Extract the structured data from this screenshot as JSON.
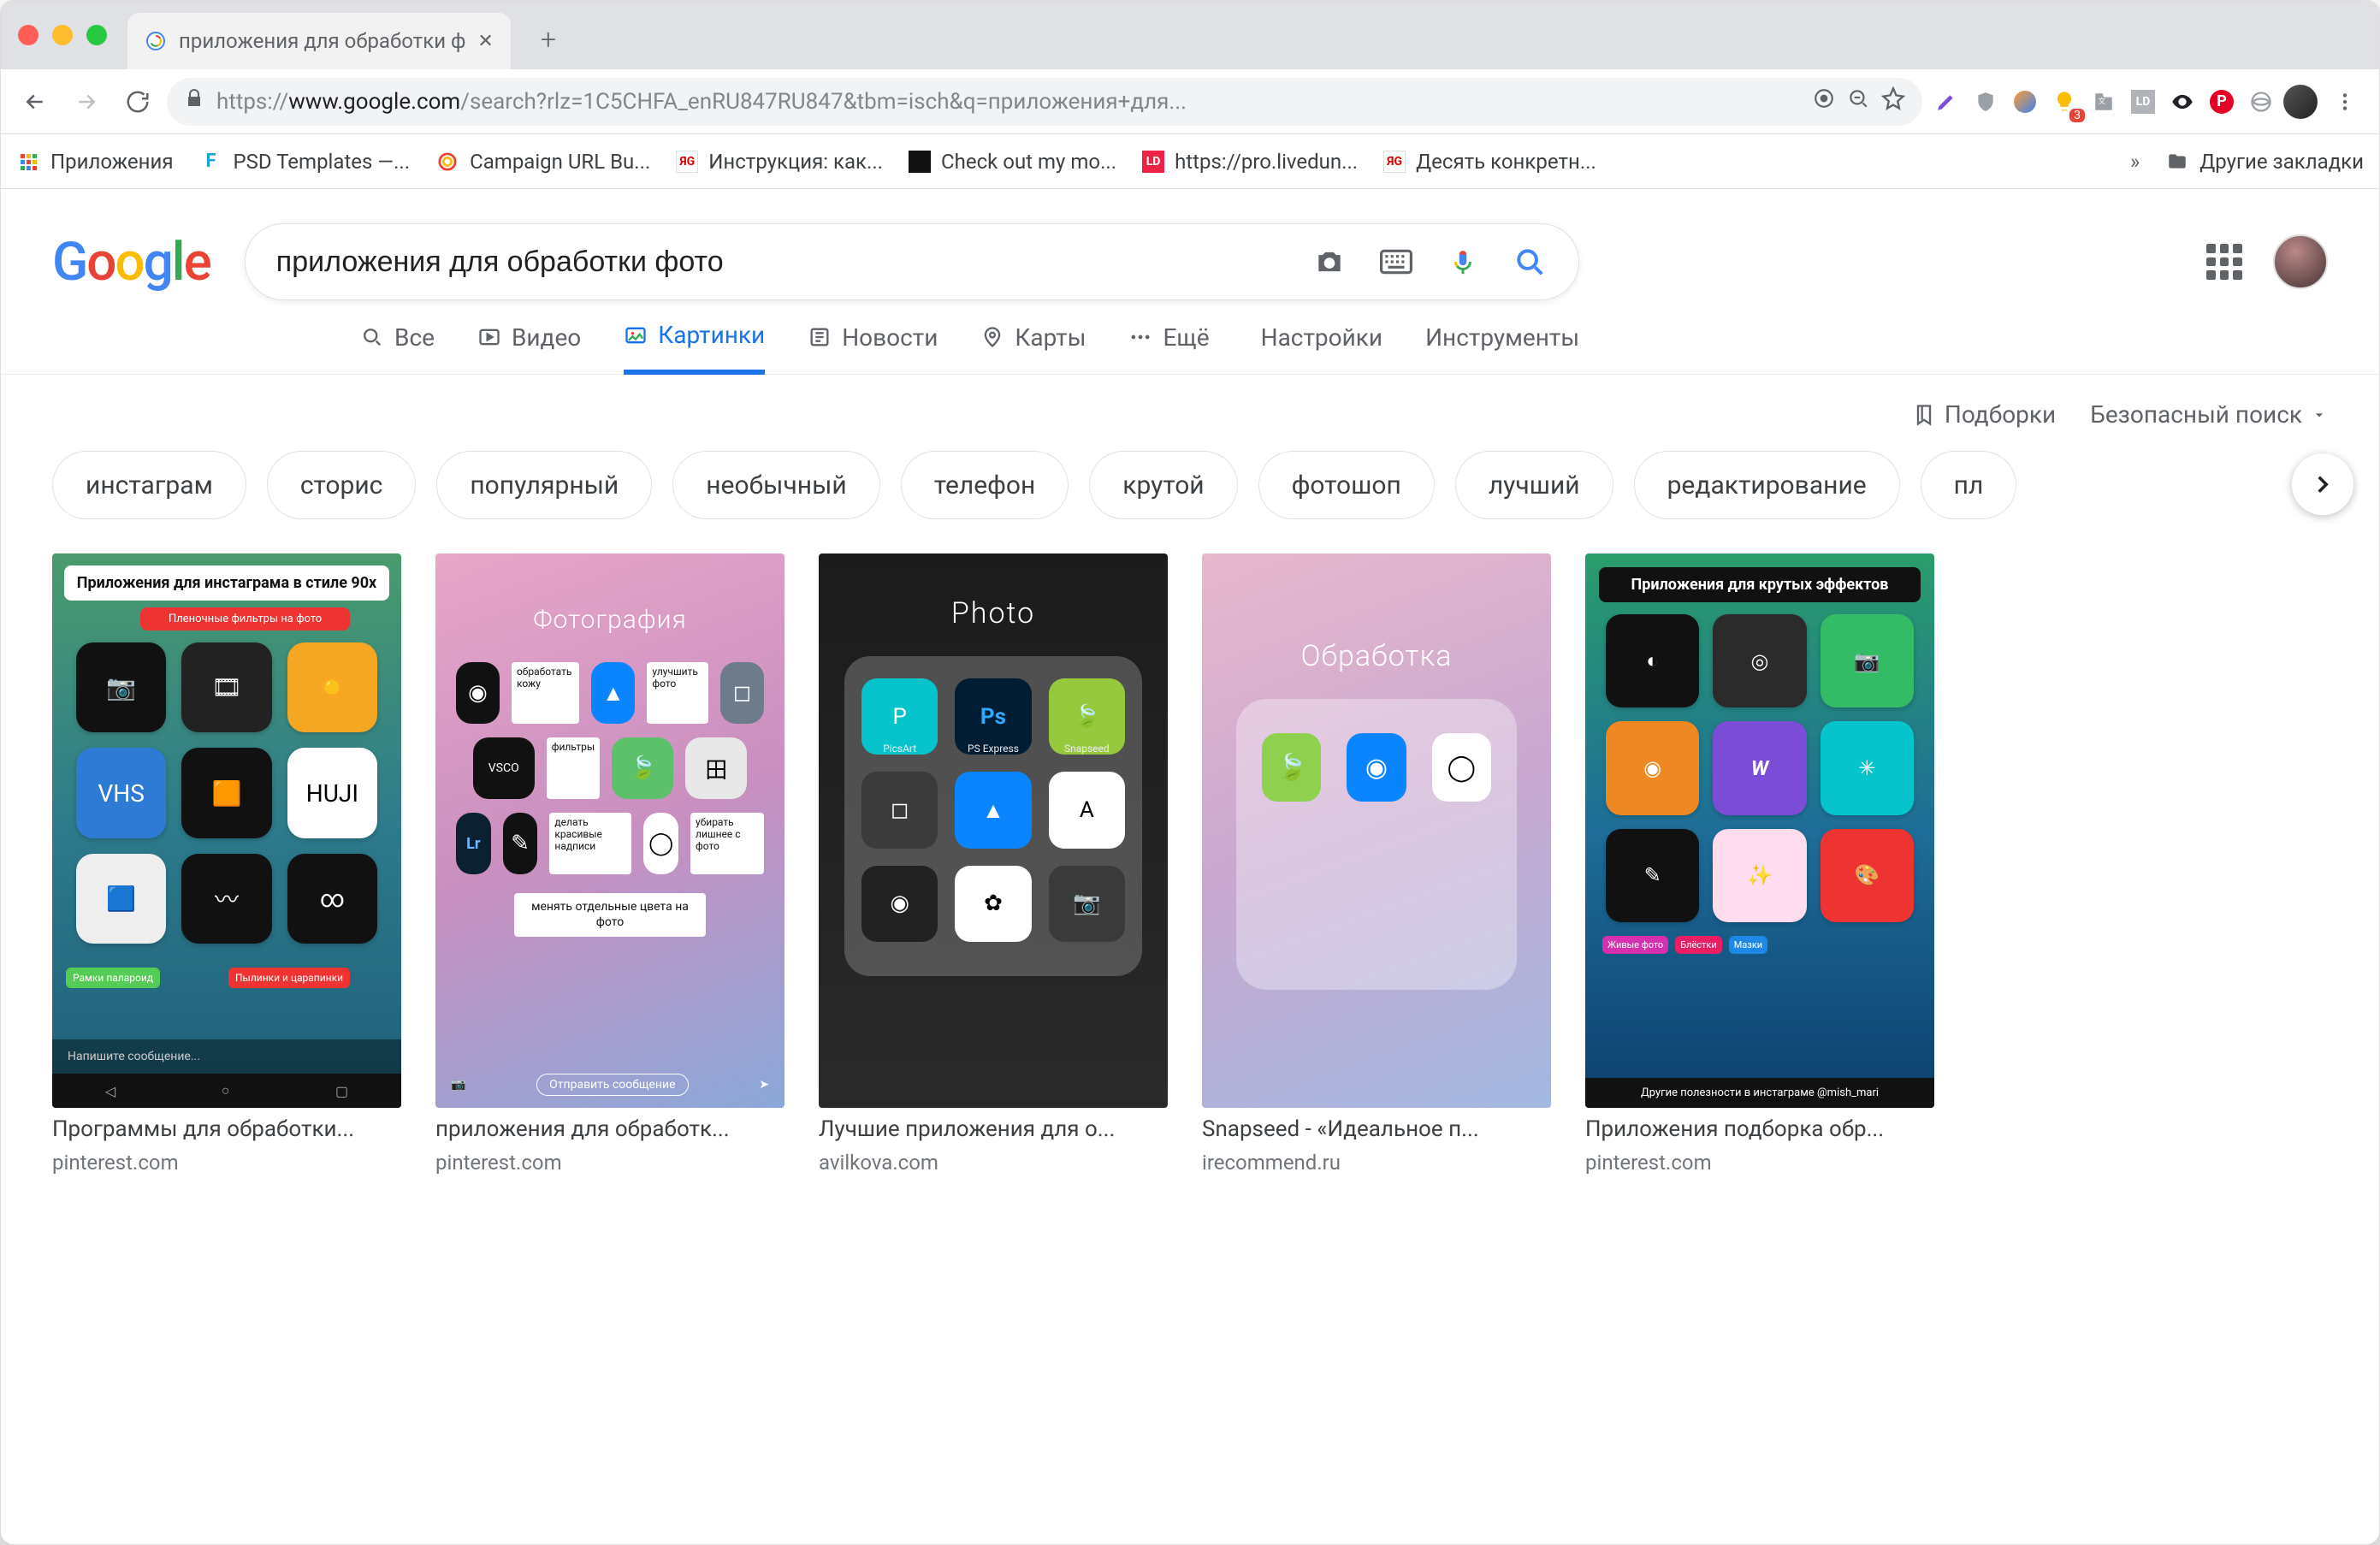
{
  "window": {
    "tab_title": "приложения для обработки ф",
    "new_tab_plus": "+"
  },
  "toolbar": {
    "url_scheme": "https://",
    "url_host": "www.google.com",
    "url_rest": "/search?rlz=1C5CHFA_enRU847RU847&tbm=isch&q=приложения+для..."
  },
  "extensions": {
    "badge_count": "3"
  },
  "bookmarks": {
    "items": [
      {
        "label": "Приложения"
      },
      {
        "label": "PSD Templates —..."
      },
      {
        "label": "Campaign URL Bu..."
      },
      {
        "label": "Инструкция: как..."
      },
      {
        "label": "Check out my mo..."
      },
      {
        "label": "https://pro.livedun..."
      },
      {
        "label": "Десять конкретн..."
      }
    ],
    "overflow": "»",
    "other": "Другие закладки"
  },
  "search": {
    "query": "приложения для обработки фото"
  },
  "tabs": {
    "all": "Все",
    "videos": "Видео",
    "images": "Картинки",
    "news": "Новости",
    "maps": "Карты",
    "more": "Ещё",
    "settings": "Настройки",
    "tools": "Инструменты"
  },
  "subrow": {
    "collections": "Подборки",
    "safesearch": "Безопасный поиск"
  },
  "chips": [
    "инстаграм",
    "сторис",
    "популярный",
    "необычный",
    "телефон",
    "крутой",
    "фотошоп",
    "лучший",
    "редактирование",
    "пл"
  ],
  "results": [
    {
      "title": "Программы для обработки...",
      "source": "pinterest.com",
      "thumb": {
        "banner": "Приложения для инстаграма в стиле 90х",
        "tag1": "Пленочные фильтры на фото",
        "tag_bottom1": "Рамки палароид",
        "tag_bottom2": "Пылинки и царапинки"
      }
    },
    {
      "title": "приложения для обработк...",
      "source": "pinterest.com",
      "thumb": {
        "header": "Фотография",
        "note": "менять отдельные цвета на фото"
      }
    },
    {
      "title": "Лучшие приложения для о...",
      "source": "avilkova.com",
      "thumb": {
        "header": "Photo",
        "apps": [
          "PicsArt",
          "PS Express",
          "Snapseed"
        ]
      }
    },
    {
      "title": "Snapseed - «Идеальное п...",
      "source": "irecommend.ru",
      "thumb": {
        "header": "Обработка"
      }
    },
    {
      "title": "Приложения подборка обр...",
      "source": "pinterest.com",
      "thumb": {
        "banner": "Приложения для крутых эффектов",
        "tag1": "Живые фото",
        "tag2": "Блёстки",
        "tag3": "Мазки",
        "footer": "Другие полезности в инстаграме @mish_mari"
      }
    }
  ]
}
